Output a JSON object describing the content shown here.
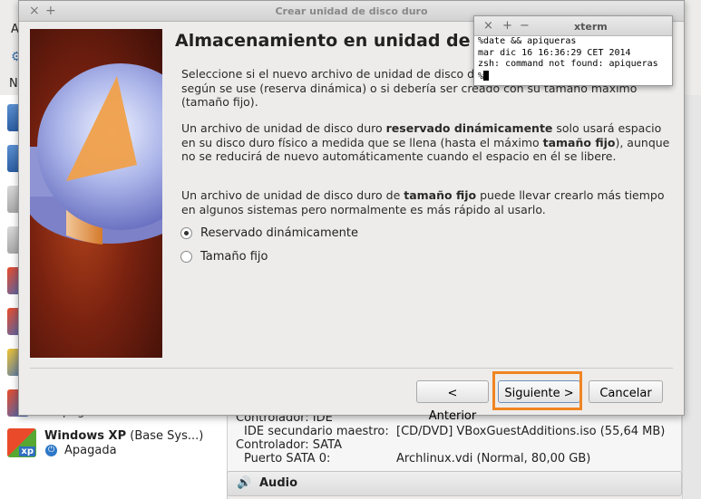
{
  "background": {
    "menu_first": "A",
    "toolbar_label": "N",
    "vm_list": {
      "partial_state": "Apaga",
      "winxp_name": "Windows XP",
      "winxp_suffix": " (Base Sys...)",
      "winxp_state": "Apagada",
      "winxp_badge": "xp"
    },
    "storage": {
      "ctrl_ide": "Controlador: IDE",
      "ide_label": "IDE secundario maestro:",
      "ide_value": "[CD/DVD] VBoxGuestAdditions.iso (55,64 MB)",
      "ctrl_sata": "Controlador: SATA",
      "sata_label": "Puerto SATA 0:",
      "sata_value": "Archlinux.vdi (Normal, 80,00 GB)"
    },
    "audio_label": "Audio",
    "vm_icon_colors": [
      "#f26b2a",
      "#f26b2a",
      "#f0c232",
      "#f0c232",
      "#e9462b",
      "#e9462b",
      "#f0c232",
      "#e9462b"
    ]
  },
  "dialog": {
    "title": "Crear unidad de disco duro",
    "close_glyph": "×",
    "plus_glyph": "+",
    "heading": "Almacenamiento en unidad de",
    "p1": "Seleccione si el nuevo archivo de unidad de disco d",
    "p1_b": "según se use (reserva dinámica) o si debería ser creado con su tamaño máximo (tamaño fijo).",
    "p2_a": "Un archivo de unidad de disco duro ",
    "p2_b": "reservado dinámicamente",
    "p2_c": " solo usará espacio en su disco duro físico a medida que se llena (hasta el máximo ",
    "p2_d": "tamaño fijo",
    "p2_e": "), aunque no se reducirá de nuevo automáticamente cuando el espacio en él se libere.",
    "p3_a": "Un archivo de unidad de disco duro de ",
    "p3_b": "tamaño fijo",
    "p3_c": " puede llevar crearlo más tiempo en algunos sistemas pero normalmente es más rápido al usarlo.",
    "radio_dynamic": "Reservado dinámicamente",
    "radio_fixed": "Tamaño fijo",
    "btn_back": "< Anterior",
    "btn_next": "Siguiente >",
    "btn_cancel": "Cancelar",
    "highlight_color": "#f08521"
  },
  "xterm": {
    "title": "xterm",
    "line1": "%date && apiqueras",
    "line2": "mar dic 16 16:36:29 CET 2014",
    "line3": "zsh: command not found: apiqueras",
    "prompt": "%"
  }
}
